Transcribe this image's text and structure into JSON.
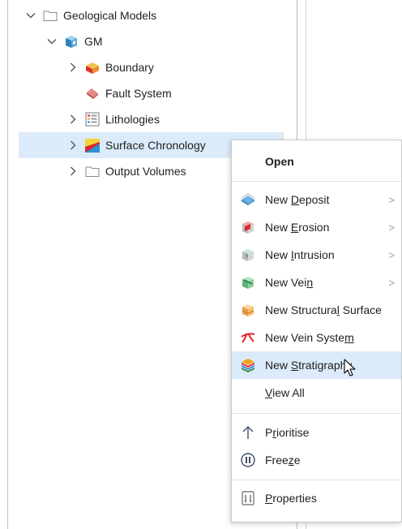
{
  "tree": {
    "items": [
      {
        "label": "Geological Models",
        "expanded": true,
        "icon": "folder-icon"
      },
      {
        "label": "GM",
        "expanded": true,
        "icon": "geological-model-icon"
      },
      {
        "label": "Boundary",
        "expanded": false,
        "icon": "boundary-icon"
      },
      {
        "label": "Fault System",
        "icon": "fault-system-icon"
      },
      {
        "label": "Lithologies",
        "expanded": false,
        "icon": "lithologies-icon"
      },
      {
        "label": "Surface Chronology",
        "expanded": false,
        "selected": true,
        "icon": "surface-chronology-icon"
      },
      {
        "label": "Output Volumes",
        "expanded": false,
        "icon": "folder-icon"
      }
    ]
  },
  "context_menu": {
    "open": {
      "label": "Open"
    },
    "new_deposit": {
      "pre": "New ",
      "u": "D",
      "post": "eposit",
      "has_submenu": true,
      "icon": "deposit-icon"
    },
    "new_erosion": {
      "pre": "New ",
      "u": "E",
      "post": "rosion",
      "has_submenu": true,
      "icon": "erosion-icon"
    },
    "new_intrusion": {
      "pre": "New ",
      "u": "I",
      "post": "ntrusion",
      "has_submenu": true,
      "icon": "intrusion-icon"
    },
    "new_vein": {
      "pre": "New Vei",
      "u": "n",
      "post": "",
      "has_submenu": true,
      "icon": "vein-icon"
    },
    "new_structural_surface": {
      "pre": "New Structura",
      "u": "l",
      "post": " Surface",
      "icon": "structural-surface-icon"
    },
    "new_vein_system": {
      "pre": "New Vein Syste",
      "u": "m",
      "post": "",
      "icon": "vein-system-icon"
    },
    "new_stratigraphy": {
      "pre": "New ",
      "u": "S",
      "post": "tratigraphy",
      "highlighted": true,
      "icon": "stratigraphy-icon"
    },
    "view_all": {
      "pre": "",
      "u": "V",
      "post": "iew All"
    },
    "prioritise": {
      "pre": "P",
      "u": "r",
      "post": "ioritise",
      "icon": "arrow-up-icon"
    },
    "freeze": {
      "pre": "Free",
      "u": "z",
      "post": "e",
      "icon": "pause-icon"
    },
    "properties": {
      "pre": "",
      "u": "P",
      "post": "roperties",
      "icon": "properties-icon"
    },
    "submenu_glyph": ">"
  },
  "colors": {
    "selection": "#dcebf9",
    "accent_red": "#e0262b"
  }
}
